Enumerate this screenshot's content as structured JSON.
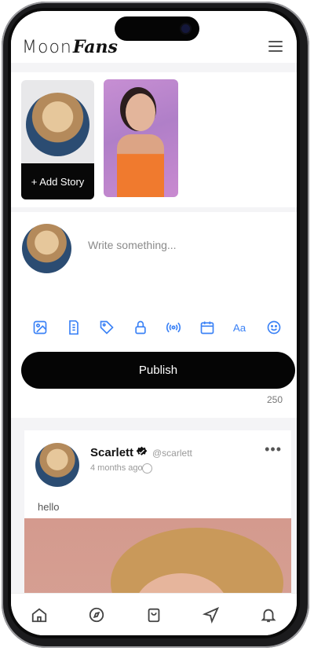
{
  "app": {
    "logo_moon": "Moon",
    "logo_fans": "Fans"
  },
  "stories": {
    "add_label": "+ Add Story"
  },
  "composer": {
    "placeholder": "Write something...",
    "publish_label": "Publish",
    "char_count": "250"
  },
  "tools": [
    "image-icon",
    "file-icon",
    "tag-icon",
    "lock-icon",
    "broadcast-icon",
    "calendar-icon",
    "text-format-icon",
    "emoji-icon"
  ],
  "post": {
    "name": "Scarlett",
    "handle": "@scarlett",
    "time": "4 months ago",
    "text": "hello"
  },
  "colors": {
    "accent": "#3b82f6",
    "button": "#050505"
  }
}
